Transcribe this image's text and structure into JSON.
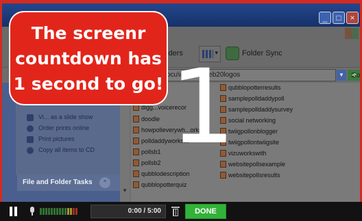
{
  "callout": {
    "lines": [
      "The screenr",
      "countdown has",
      "1 second to go!"
    ],
    "color": "#e2251b"
  },
  "countdown": {
    "number": "1"
  },
  "explorer": {
    "toolbar": {
      "folders_label": "lders",
      "folder_sync_label": "Folder Sync"
    },
    "address": {
      "value": "ocu\\images\\web20logos",
      "go_label": "Go"
    },
    "tasks": [
      "Vi... as a slide show",
      "Order prints online",
      "Print pictures",
      "Copy all items to CD"
    ],
    "file_folder_tasks": "File and Folder Tasks",
    "files_col1": [
      "digg...voicerecor",
      "doodle",
      "howpolleverywh...orks",
      "polldaddyworks...",
      "pollsb1",
      "pollsb2",
      "qubblodescription",
      "qubblopotterquiz"
    ],
    "files_col2": [
      "qubblopotterresults",
      "samplepolldaddypoll",
      "samplepolldaddysurvey",
      "social networking",
      "twiigpollonblogger",
      "twiigpollontwiigsite",
      "vizuworkswith",
      "websitepollsexample",
      "websitepollsresults"
    ]
  },
  "controls": {
    "time": "0:00 / 5:00",
    "done_label": "DONE",
    "done_color": "#33b23a"
  }
}
